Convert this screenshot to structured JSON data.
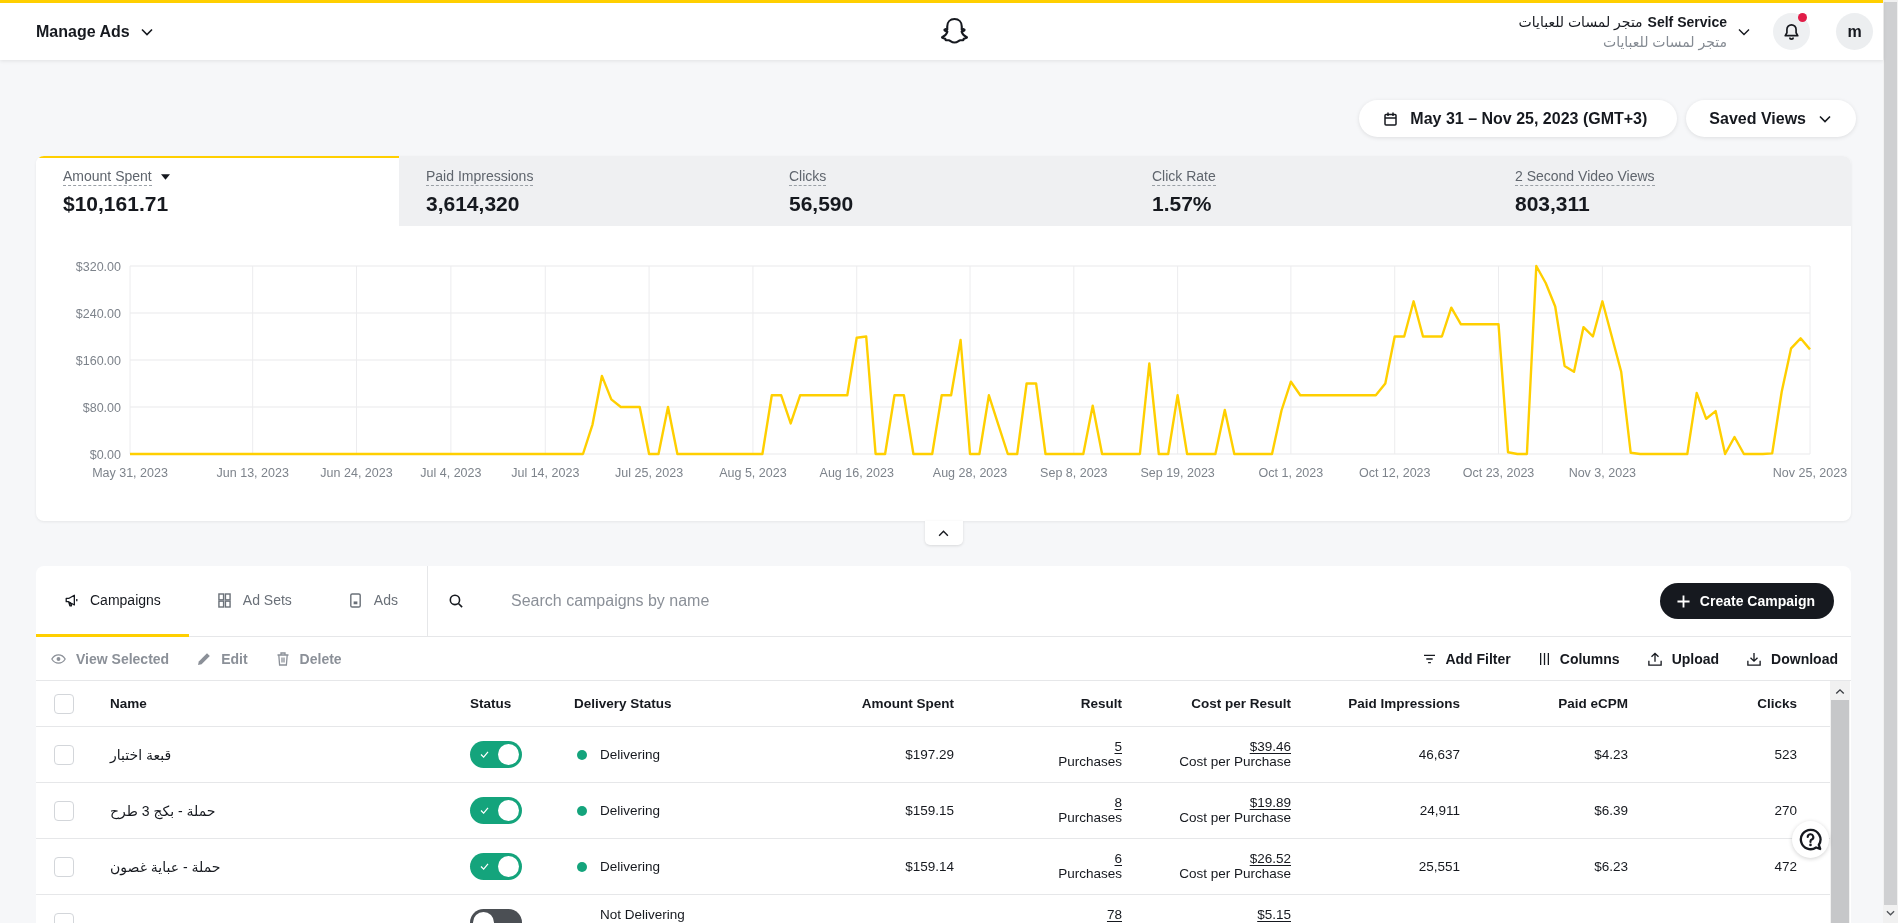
{
  "top_bar": {
    "title": "Manage Ads",
    "account_name": "متجر لمسات للعبايات",
    "organization": "Self Service",
    "account_subtitle": "متجر لمسات للعبايات",
    "unread_notifications": true,
    "avatar_initial": "m"
  },
  "view_controls": {
    "date_range": "May 31 – Nov 25, 2023 (GMT+3)",
    "saved_views": "Saved Views"
  },
  "metrics": {
    "tabs": [
      {
        "label": "Amount Spent",
        "value": "$10,161.71",
        "selected": true,
        "dropdown": true
      },
      {
        "label": "Paid Impressions",
        "value": "3,614,320",
        "selected": false,
        "dropdown": false
      },
      {
        "label": "Clicks",
        "value": "56,590",
        "selected": false,
        "dropdown": false
      },
      {
        "label": "Click Rate",
        "value": "1.57%",
        "selected": false,
        "dropdown": false
      },
      {
        "label": "2 Second Video Views",
        "value": "803,311",
        "selected": false,
        "dropdown": false
      }
    ],
    "chart_data": {
      "type": "line",
      "grid": true,
      "categories": [
        "May 31, 2023",
        null,
        null,
        null,
        null,
        null,
        null,
        null,
        null,
        null,
        null,
        null,
        null,
        "Jun 13, 2023",
        null,
        null,
        null,
        null,
        null,
        null,
        null,
        null,
        null,
        null,
        "Jun 24, 2023",
        null,
        null,
        null,
        null,
        null,
        null,
        null,
        null,
        null,
        "Jul 4, 2023",
        null,
        null,
        null,
        null,
        null,
        null,
        null,
        null,
        null,
        "Jul 14, 2023",
        null,
        null,
        null,
        null,
        null,
        null,
        null,
        null,
        null,
        null,
        "Jul 25, 2023",
        null,
        null,
        null,
        null,
        null,
        null,
        null,
        null,
        null,
        null,
        "Aug 5, 2023",
        null,
        null,
        null,
        null,
        null,
        null,
        null,
        null,
        null,
        null,
        "Aug 16, 2023",
        null,
        null,
        null,
        null,
        null,
        null,
        null,
        null,
        null,
        null,
        null,
        "Aug 28, 2023",
        null,
        null,
        null,
        null,
        null,
        null,
        null,
        null,
        null,
        null,
        "Sep 8, 2023",
        null,
        null,
        null,
        null,
        null,
        null,
        null,
        null,
        null,
        null,
        "Sep 19, 2023",
        null,
        null,
        null,
        null,
        null,
        null,
        null,
        null,
        null,
        null,
        null,
        "Oct 1, 2023",
        null,
        null,
        null,
        null,
        null,
        null,
        null,
        null,
        null,
        null,
        "Oct 12, 2023",
        null,
        null,
        null,
        null,
        null,
        null,
        null,
        null,
        null,
        null,
        "Oct 23, 2023",
        null,
        null,
        null,
        null,
        null,
        null,
        null,
        null,
        null,
        null,
        "Nov 3, 2023",
        null,
        null,
        null,
        null,
        null,
        null,
        null,
        null,
        null,
        null,
        null,
        null,
        null,
        null,
        null,
        null,
        null,
        null,
        null,
        null,
        null,
        "Nov 25, 2023"
      ],
      "series": [
        {
          "color": "#ffcf00",
          "values": [
            0,
            0,
            0,
            0,
            0,
            0,
            0,
            0,
            0,
            0,
            0,
            0,
            0,
            0,
            0,
            0,
            0,
            0,
            0,
            0,
            0,
            0,
            0,
            0,
            0,
            0,
            0,
            0,
            0,
            0,
            0,
            0,
            0,
            0,
            0,
            0,
            0,
            0,
            0,
            0,
            0,
            0,
            0,
            0,
            0,
            0,
            0,
            0,
            0,
            50,
            133,
            93,
            80,
            80,
            80,
            0,
            0,
            80,
            0,
            0,
            0,
            0,
            0,
            0,
            0,
            0,
            0,
            0,
            100,
            100,
            52,
            100,
            100,
            100,
            100,
            100,
            100,
            198,
            200,
            0,
            0,
            100,
            100,
            0,
            0,
            0,
            100,
            100,
            194,
            0,
            0,
            100,
            50,
            0,
            0,
            120,
            120,
            0,
            0,
            0,
            0,
            0,
            82,
            0,
            0,
            0,
            0,
            0,
            154,
            0,
            0,
            100,
            0,
            0,
            0,
            0,
            75,
            0,
            0,
            0,
            0,
            0,
            74,
            123,
            100,
            100,
            100,
            100,
            100,
            100,
            100,
            100,
            100,
            120,
            200,
            200,
            260,
            200,
            200,
            200,
            249,
            221,
            221,
            221,
            221,
            221,
            3,
            0,
            0,
            320,
            291,
            251,
            150,
            140,
            216,
            200,
            260,
            200,
            140,
            2,
            0,
            0,
            0,
            0,
            0,
            0,
            104,
            60,
            73,
            0,
            29,
            0,
            0,
            0,
            1,
            106,
            180,
            197,
            178
          ]
        }
      ],
      "ylim": [
        0,
        320
      ],
      "yticks": [
        {
          "value": 0,
          "label": "$0.00"
        },
        {
          "value": 80,
          "label": "$80.00"
        },
        {
          "value": 160,
          "label": "$160.00"
        },
        {
          "value": 240,
          "label": "$240.00"
        },
        {
          "value": 320,
          "label": "$320.00"
        }
      ]
    }
  },
  "campaigns": {
    "tabs": [
      {
        "kind": "campaigns",
        "label": "Campaigns",
        "selected": true
      },
      {
        "kind": "ad_sets",
        "label": "Ad Sets",
        "selected": false
      },
      {
        "kind": "ads",
        "label": "Ads",
        "selected": false
      }
    ],
    "search": {
      "placeholder": "Search campaigns by name"
    },
    "create_button": "Create Campaign",
    "row_actions": [
      {
        "kind": "view",
        "label": "View Selected",
        "disabled": true
      },
      {
        "kind": "edit",
        "label": "Edit",
        "disabled": true
      },
      {
        "kind": "delete",
        "label": "Delete",
        "disabled": true
      }
    ],
    "table_actions": [
      {
        "kind": "filter",
        "label": "Add Filter"
      },
      {
        "kind": "columns",
        "label": "Columns"
      },
      {
        "kind": "upload",
        "label": "Upload"
      },
      {
        "kind": "download",
        "label": "Download"
      }
    ],
    "table": {
      "select_all_checked": false,
      "columns": [
        "Name",
        "Status",
        "Delivery Status",
        "Amount Spent",
        "Result",
        "Cost per Result",
        "Paid Impressions",
        "Paid eCPM",
        "Clicks"
      ],
      "rows": [
        {
          "checked": false,
          "name": "قبعة اختبار",
          "on": true,
          "delivery": "Delivering",
          "color": "#14a47c",
          "amount_spent": "$197.29",
          "result": "5",
          "result_type": "Purchases",
          "cost_per_result": "$39.46",
          "cost_type": "Cost per Purchase",
          "paid_impressions": "46,637",
          "paid_ecpm": "$4.23",
          "clicks": "523"
        },
        {
          "checked": false,
          "name": "حملة - بكج 3 طرح",
          "on": true,
          "delivery": "Delivering",
          "color": "#14a47c",
          "amount_spent": "$159.15",
          "result": "8",
          "result_type": "Purchases",
          "cost_per_result": "$19.89",
          "cost_type": "Cost per Purchase",
          "paid_impressions": "24,911",
          "paid_ecpm": "$6.39",
          "clicks": "270"
        },
        {
          "checked": false,
          "name": "حملة - عباية غصون",
          "on": true,
          "delivery": "Delivering",
          "color": "#14a47c",
          "amount_spent": "$159.14",
          "result": "6",
          "result_type": "Purchases",
          "cost_per_result": "$26.52",
          "cost_type": "Cost per Purchase",
          "paid_impressions": "25,551",
          "paid_ecpm": "$6.23",
          "clicks": "472"
        },
        {
          "checked": false,
          "on": false,
          "delivery": "Not Delivering",
          "result": "78",
          "cost_per_result": "$5.15"
        }
      ]
    }
  }
}
